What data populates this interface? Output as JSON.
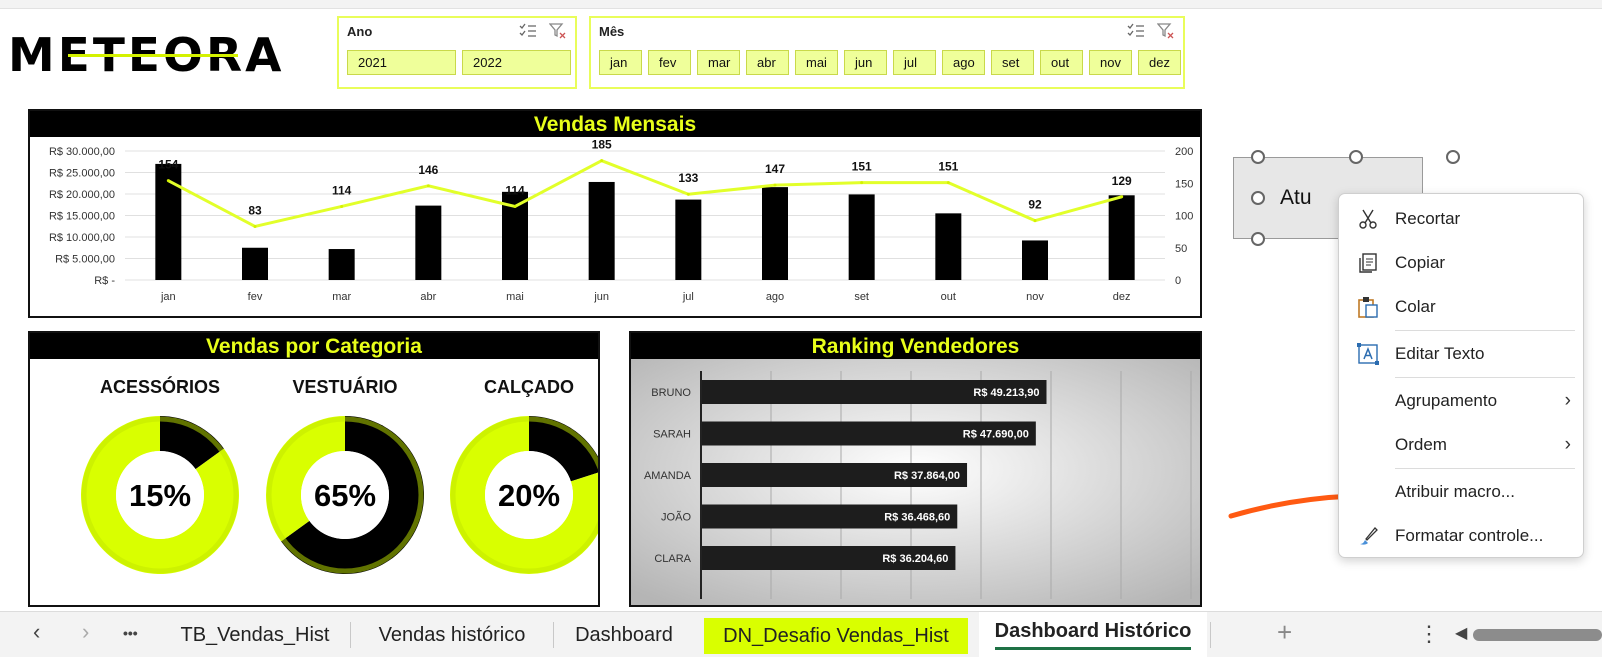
{
  "logo": {
    "text": "METEORA"
  },
  "slicer_ano": {
    "title": "Ano",
    "options": [
      "2021",
      "2022"
    ]
  },
  "slicer_mes": {
    "title": "Mês",
    "options": [
      "jan",
      "fev",
      "mar",
      "abr",
      "mai",
      "jun",
      "jul",
      "ago",
      "set",
      "out",
      "nov",
      "dez"
    ]
  },
  "monthly": {
    "title": "Vendas Mensais",
    "y_left_ticks": [
      "R$ 30.000,00",
      "R$ 25.000,00",
      "R$ 20.000,00",
      "R$ 15.000,00",
      "R$ 10.000,00",
      "R$ 5.000,00",
      "R$ -"
    ],
    "y_right_ticks": [
      "200",
      "150",
      "100",
      "50",
      "0"
    ]
  },
  "category": {
    "title": "Vendas por Categoria",
    "items": [
      {
        "name": "ACESSÓRIOS",
        "percent_label": "15%",
        "value": 0.15
      },
      {
        "name": "VESTUÁRIO",
        "percent_label": "65%",
        "value": 0.65
      },
      {
        "name": "CALÇADO",
        "percent_label": "20%",
        "value": 0.2
      }
    ]
  },
  "ranking": {
    "title": "Ranking Vendedores"
  },
  "chart_data": [
    {
      "type": "bar",
      "title": "Vendas Mensais",
      "categories": [
        "jan",
        "fev",
        "mar",
        "abr",
        "mai",
        "jun",
        "jul",
        "ago",
        "set",
        "out",
        "nov",
        "dez"
      ],
      "series": [
        {
          "values": [
            27000,
            7500,
            7200,
            17300,
            20500,
            22800,
            18700,
            21600,
            19900,
            15500,
            9200,
            19700
          ]
        },
        {
          "values": [
            154,
            83,
            114,
            146,
            114,
            185,
            133,
            147,
            151,
            151,
            92,
            129
          ]
        }
      ],
      "ylim": [
        0,
        30000
      ],
      "y2lim": [
        0,
        200
      ],
      "data_labels": [
        "154",
        "83",
        "114",
        "146",
        "114",
        "185",
        "133",
        "147",
        "151",
        "151",
        "92",
        "129"
      ],
      "grid": true
    },
    {
      "type": "bar",
      "title": "Ranking Vendedores",
      "categories": [
        "BRUNO",
        "SARAH",
        "AMANDA",
        "JOÃO",
        "CLARA"
      ],
      "values": [
        49213.9,
        47690.0,
        37864.0,
        36468.6,
        36204.6
      ],
      "data_labels": [
        "R$ 49.213,90",
        "R$ 47.690,00",
        "R$ 37.864,00",
        "R$ 36.468,60",
        "R$ 36.204,60"
      ],
      "grid": true
    }
  ],
  "colors": {
    "accent": "#d9ff00",
    "dark": "#000000",
    "annotation": "#ff5a12"
  },
  "shape_button": {
    "label": "Atu"
  },
  "context_menu": {
    "items": [
      {
        "label": "Recortar",
        "icon": "scissors-icon"
      },
      {
        "label": "Copiar",
        "icon": "copy-icon"
      },
      {
        "label": "Colar",
        "icon": "paste-icon"
      },
      {
        "label": "Editar Texto",
        "icon": "edit-text-icon"
      },
      {
        "label": "Agrupamento",
        "icon": ""
      },
      {
        "label": "Ordem",
        "icon": ""
      },
      {
        "label": "Atribuir macro...",
        "icon": ""
      },
      {
        "label": "Formatar controle...",
        "icon": "format-control-icon"
      }
    ]
  },
  "sheet_tabs": {
    "more": "•••",
    "tabs": [
      "TB_Vendas_Hist",
      "Vendas histórico",
      "Dashboard",
      "DN_Desafio Vendas_Hist",
      "Dashboard Histórico"
    ],
    "active": "Dashboard Histórico",
    "add": "+",
    "menu": "⋮"
  }
}
